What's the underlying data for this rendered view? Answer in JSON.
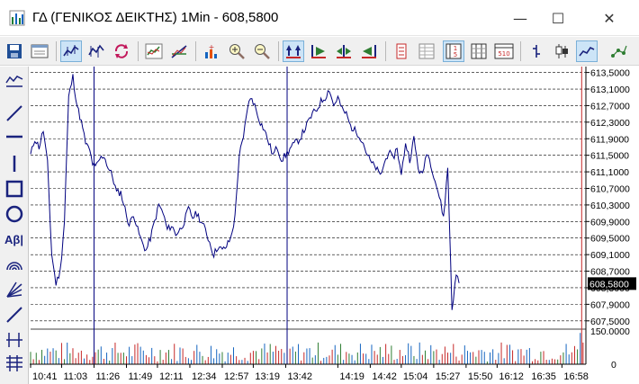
{
  "window": {
    "title": "ΓΔ (ΓΕΝΙΚΟΣ ΔΕΙΚΤΗΣ) 1Min - 608,5800",
    "minimize_glyph": "—",
    "maximize_glyph": "☐",
    "close_glyph": "✕"
  },
  "toolbar": {
    "buttons": [
      {
        "name": "save-icon",
        "active": false
      },
      {
        "name": "properties-icon",
        "active": false
      },
      {
        "name": "line-chart-mode-icon",
        "active": true
      },
      {
        "name": "ohlc-mode-icon",
        "active": false
      },
      {
        "name": "refresh-icon",
        "active": false
      },
      {
        "name": "indicator-chart-icon",
        "active": false
      },
      {
        "name": "trendline-chart-icon",
        "active": false
      },
      {
        "name": "volume-plus-icon",
        "active": false
      },
      {
        "name": "zoom-in-icon",
        "active": false
      },
      {
        "name": "zoom-out-icon",
        "active": false
      },
      {
        "name": "fit-vertical-icon",
        "active": true
      },
      {
        "name": "scroll-right-icon",
        "active": false
      },
      {
        "name": "scroll-both-icon",
        "active": false
      },
      {
        "name": "scroll-left-icon",
        "active": false
      },
      {
        "name": "data-window-icon",
        "active": false
      },
      {
        "name": "grid-table-icon",
        "active": false
      },
      {
        "name": "period-5-icon",
        "active": true
      },
      {
        "name": "columns-icon",
        "active": false
      },
      {
        "name": "period-510-icon",
        "active": false
      },
      {
        "name": "bar-style-icon",
        "active": false
      },
      {
        "name": "candle-style-icon",
        "active": false
      },
      {
        "name": "line-style-icon",
        "active": true
      },
      {
        "name": "scatter-style-icon",
        "active": false
      }
    ]
  },
  "drawing_tools": [
    {
      "name": "chart-type-icon",
      "label": ""
    },
    {
      "name": "line-tool-icon",
      "label": ""
    },
    {
      "name": "horizontal-line-tool-icon",
      "label": ""
    },
    {
      "name": "vertical-line-tool-icon",
      "label": ""
    },
    {
      "name": "rectangle-tool-icon",
      "label": ""
    },
    {
      "name": "ellipse-tool-icon",
      "label": ""
    },
    {
      "name": "text-tool-icon",
      "label": "Aβ|"
    },
    {
      "name": "arc-tool-icon",
      "label": ""
    },
    {
      "name": "fan-tool-icon",
      "label": ""
    },
    {
      "name": "channel-tool-icon",
      "label": ""
    },
    {
      "name": "cycles-tool-icon",
      "label": ""
    },
    {
      "name": "fibonacci-tool-icon",
      "label": ""
    }
  ],
  "chart_data": {
    "type": "line",
    "symbol": "ΓΔ (ΓΕΝΙΚΟΣ ΔΕΙΚΤΗΣ)",
    "interval": "1Min",
    "last_value": "608,5800",
    "y_tick_labels": [
      "613,5000",
      "613,1000",
      "612,7000",
      "612,3000",
      "611,9000",
      "611,5000",
      "611,1000",
      "610,7000",
      "610,3000",
      "609,9000",
      "609,5000",
      "609,1000",
      "608,7000",
      "608,3000",
      "607,9000",
      "607,5000"
    ],
    "y_ticks": [
      613.5,
      613.1,
      612.7,
      612.3,
      611.9,
      611.5,
      611.1,
      610.7,
      610.3,
      609.9,
      609.5,
      609.1,
      608.7,
      608.3,
      607.9,
      607.5
    ],
    "ylim": [
      607.3,
      613.6
    ],
    "x_tick_labels": [
      "10:41",
      "11:03",
      "11:26",
      "11:49",
      "12:11",
      "12:34",
      "12:57",
      "13:19",
      "13:42",
      "14:19",
      "14:42",
      "15:04",
      "15:27",
      "15:50",
      "16:12",
      "16:35",
      "16:58"
    ],
    "x_tick_index": [
      0,
      22,
      45,
      68,
      90,
      113,
      136,
      158,
      181,
      218,
      241,
      263,
      286,
      309,
      331,
      354,
      377
    ],
    "marker_lines_index": [
      45,
      182
    ],
    "current_line_index": 391,
    "price": {
      "line_color": "#00007f",
      "x": [
        0,
        3,
        6,
        9,
        12,
        15,
        18,
        21,
        24,
        27,
        30,
        33,
        36,
        39,
        42,
        44,
        46,
        49,
        52,
        55,
        58,
        61,
        64,
        67,
        70,
        73,
        76,
        79,
        82,
        85,
        88,
        91,
        94,
        97,
        100,
        103,
        106,
        109,
        112,
        115,
        118,
        121,
        124,
        127,
        130,
        133,
        136,
        139,
        142,
        145,
        148,
        151,
        154,
        157,
        160,
        163,
        166,
        169,
        172,
        175,
        178,
        181,
        183,
        185,
        188,
        191,
        194,
        197,
        200,
        203,
        206,
        209,
        212,
        215,
        218,
        221,
        224,
        227,
        230,
        233,
        236,
        239,
        242,
        245,
        248,
        251,
        254,
        257,
        260,
        263,
        266,
        269,
        272,
        275,
        278,
        281,
        284,
        287,
        290,
        293,
        296,
        299,
        302,
        305,
        308,
        311,
        314,
        317,
        320,
        323,
        326,
        329,
        332,
        335,
        338,
        341,
        344,
        347,
        350,
        353,
        356,
        359,
        362,
        365,
        368,
        371,
        374,
        377,
        380,
        383,
        386,
        388,
        390,
        392,
        394
      ],
      "y": [
        611.5,
        611.9,
        611.7,
        612.1,
        611.3,
        609.1,
        608.4,
        608.7,
        609.9,
        612.9,
        613.4,
        612.7,
        612.3,
        611.8,
        611.6,
        611.3,
        611.2,
        611.4,
        611.5,
        611.2,
        611.0,
        610.6,
        610.6,
        610.2,
        609.8,
        610.1,
        609.7,
        609.4,
        609.2,
        609.5,
        609.9,
        610.3,
        610.1,
        609.7,
        609.8,
        609.6,
        609.7,
        609.9,
        610.2,
        610.0,
        610.1,
        609.9,
        609.7,
        609.4,
        609.1,
        609.3,
        609.2,
        609.3,
        609.5,
        610.0,
        611.5,
        611.9,
        612.7,
        612.9,
        612.6,
        612.3,
        612.1,
        611.8,
        611.5,
        611.7,
        611.4,
        611.5,
        611.6,
        611.7,
        611.8,
        611.9,
        612.1,
        612.3,
        612.5,
        612.6,
        612.8,
        612.9,
        613.1,
        612.7,
        612.9,
        612.6,
        612.5,
        612.2,
        612.1,
        612.0,
        611.8,
        611.5,
        611.3,
        611.2,
        611.0,
        611.3,
        611.6,
        611.4,
        611.7,
        611.0,
        611.8,
        611.4,
        611.9,
        611.2,
        611.0,
        611.6,
        611.3,
        610.9,
        610.5,
        610.0,
        611.2,
        607.8,
        608.6,
        608.4
      ]
    },
    "volume": {
      "y_tick_labels": [
        "150.0000",
        "0"
      ],
      "ylim": [
        0,
        150000
      ]
    }
  }
}
